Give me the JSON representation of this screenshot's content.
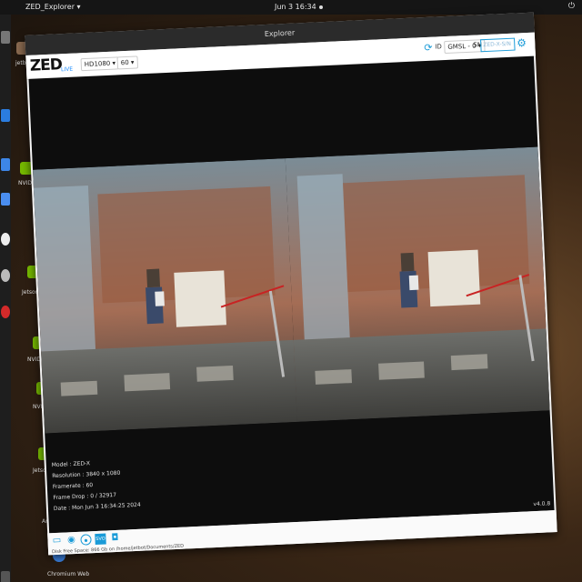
{
  "system": {
    "apps_label": "",
    "app_menu": "ZED_Explorer ▾",
    "clock": "Jun 3  16:34"
  },
  "window": {
    "title": "Explorer",
    "logo": "ZED",
    "live_label": "LIVE",
    "resolution": "HD1080",
    "fps": "60",
    "id_label": "ID",
    "camera": "GMSL - 0",
    "sn_label": "SN",
    "serial_placeholder": "ZED-X-S/N",
    "version": "v4.0.8"
  },
  "info": {
    "model": "Model : ZED-X",
    "resolution": "Resolution : 3840 x 1080",
    "framerate": "Framerate : 60",
    "frame_drop": "Frame Drop : 0 / 32917",
    "date": "Date : Mon Jun 3 16:34:25 2024"
  },
  "bottom": {
    "disk": "Disk Free Space: 866 Gb on /home/jetbot/Documents/ZED"
  },
  "desktop": {
    "labels": [
      "jetbot",
      "NVIDIA Jetson",
      "Jetson S... Forum",
      "NVIDIA Developer",
      "NVIDIA...",
      "Jetson Community",
      "Arduino",
      "Chromium Web"
    ]
  },
  "icons": {
    "sync": "sync-icon",
    "gear": "gear-icon",
    "folder": "folder-icon",
    "stream": "stream-icon",
    "record": "record-icon",
    "svo": "svo-icon",
    "camera": "camera-icon"
  }
}
